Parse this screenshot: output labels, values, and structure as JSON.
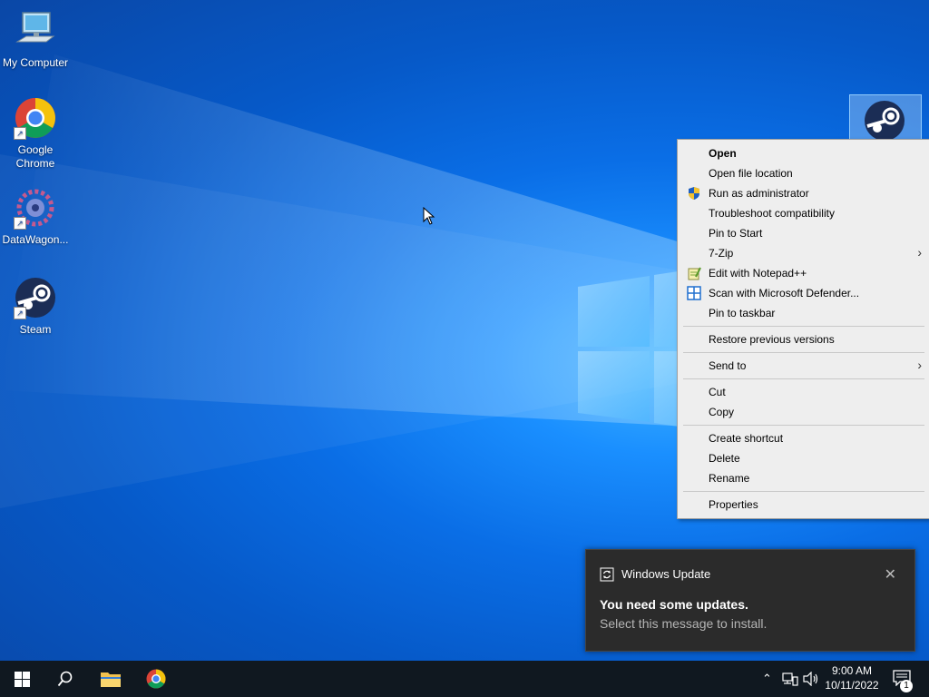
{
  "desktop": {
    "icons": [
      {
        "label": "My Computer",
        "icon": "computer-icon"
      },
      {
        "label": "Google Chrome",
        "icon": "chrome-icon"
      },
      {
        "label": "DataWagon...",
        "icon": "datawagon-icon"
      },
      {
        "label": "Steam",
        "icon": "steam-icon"
      }
    ]
  },
  "context_menu": {
    "items": [
      {
        "label": "Open",
        "bold": true
      },
      {
        "label": "Open file location"
      },
      {
        "label": "Run as administrator",
        "icon": "shield-icon"
      },
      {
        "label": "Troubleshoot compatibility"
      },
      {
        "label": "Pin to Start"
      },
      {
        "label": "7-Zip",
        "submenu": true
      },
      {
        "label": "Edit with Notepad++",
        "icon": "notepad-icon"
      },
      {
        "label": "Scan with Microsoft Defender...",
        "icon": "defender-icon"
      },
      {
        "label": "Pin to taskbar"
      },
      {
        "label": "Restore previous versions"
      },
      {
        "label": "Send to",
        "submenu": true
      },
      {
        "label": "Cut"
      },
      {
        "label": "Copy"
      },
      {
        "label": "Create shortcut"
      },
      {
        "label": "Delete"
      },
      {
        "label": "Rename"
      },
      {
        "label": "Properties"
      }
    ]
  },
  "notification": {
    "app": "Windows Update",
    "title": "You need some updates.",
    "body": "Select this message to install."
  },
  "taskbar": {
    "time": "9:00 AM",
    "date": "10/11/2022",
    "notification_count": "1"
  },
  "colors": {
    "accent": "#0078d7",
    "taskbar": "#101820",
    "menu_bg": "#eeeeee",
    "toast_bg": "#2b2b2b"
  }
}
